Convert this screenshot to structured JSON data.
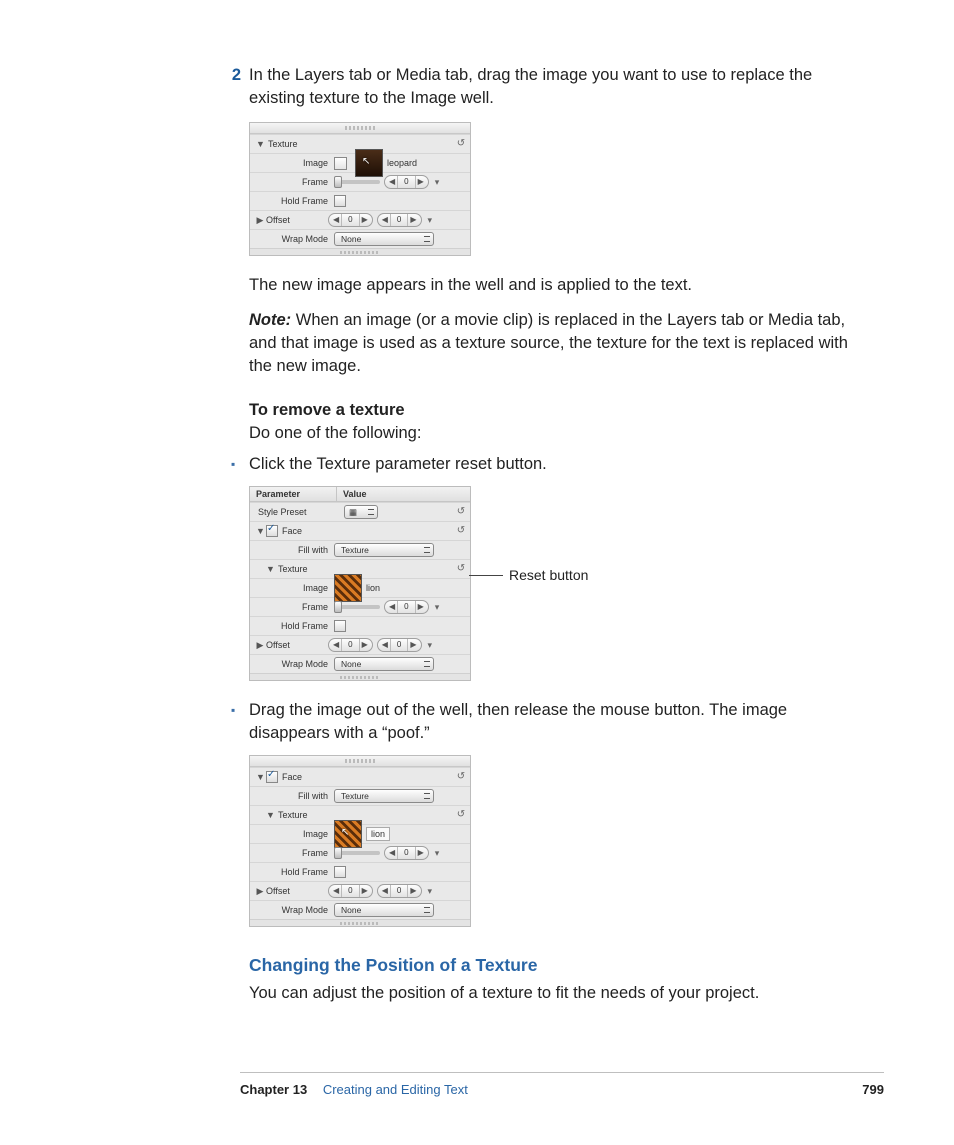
{
  "step": {
    "number": "2",
    "text": "In the Layers tab or Media tab, drag the image you want to use to replace the existing texture to the Image well."
  },
  "para_after_panel1": "The new image appears in the well and is applied to the text.",
  "note_label": "Note:",
  "note_text": "  When an image (or a movie clip) is replaced in the Layers tab or Media tab, and that image is used as a texture source, the texture for the text is replaced with the new image.",
  "subhead": "To remove a texture",
  "subhead_body": "Do one of the following:",
  "bullet1": "Click the Texture parameter reset button.",
  "bullet2": "Drag the image out of the well, then release the mouse button. The image disappears with a “poof.”",
  "blue_heading": "Changing the Position of a Texture",
  "blue_body": "You can adjust the position of a texture to fit the needs of your project.",
  "panel1": {
    "texture_label": "Texture",
    "image_label": "Image",
    "image_name": "leopard",
    "frame_label": "Frame",
    "frame_value": "0",
    "hold_label": "Hold Frame",
    "offset_label": "Offset",
    "offset_x": "0",
    "offset_y": "0",
    "wrap_label": "Wrap Mode",
    "wrap_value": "None"
  },
  "panel2": {
    "header_param": "Parameter",
    "header_value": "Value",
    "style_preset": "Style Preset",
    "face": "Face",
    "fill_with": "Fill with",
    "fill_value": "Texture",
    "texture_label": "Texture",
    "image_label": "Image",
    "image_name": "lion",
    "frame_label": "Frame",
    "frame_value": "0",
    "hold_label": "Hold Frame",
    "offset_label": "Offset",
    "offset_x": "0",
    "offset_y": "0",
    "wrap_label": "Wrap Mode",
    "wrap_value": "None"
  },
  "callout": "Reset button",
  "panel3": {
    "face": "Face",
    "fill_with": "Fill with",
    "fill_value": "Texture",
    "texture_label": "Texture",
    "image_label": "Image",
    "image_name": "lion",
    "frame_label": "Frame",
    "frame_value": "0",
    "hold_label": "Hold Frame",
    "offset_label": "Offset",
    "offset_x": "0",
    "offset_y": "0",
    "wrap_label": "Wrap Mode",
    "wrap_value": "None"
  },
  "footer": {
    "chapter_label": "Chapter 13",
    "chapter_title": "Creating and Editing Text",
    "page": "799"
  }
}
